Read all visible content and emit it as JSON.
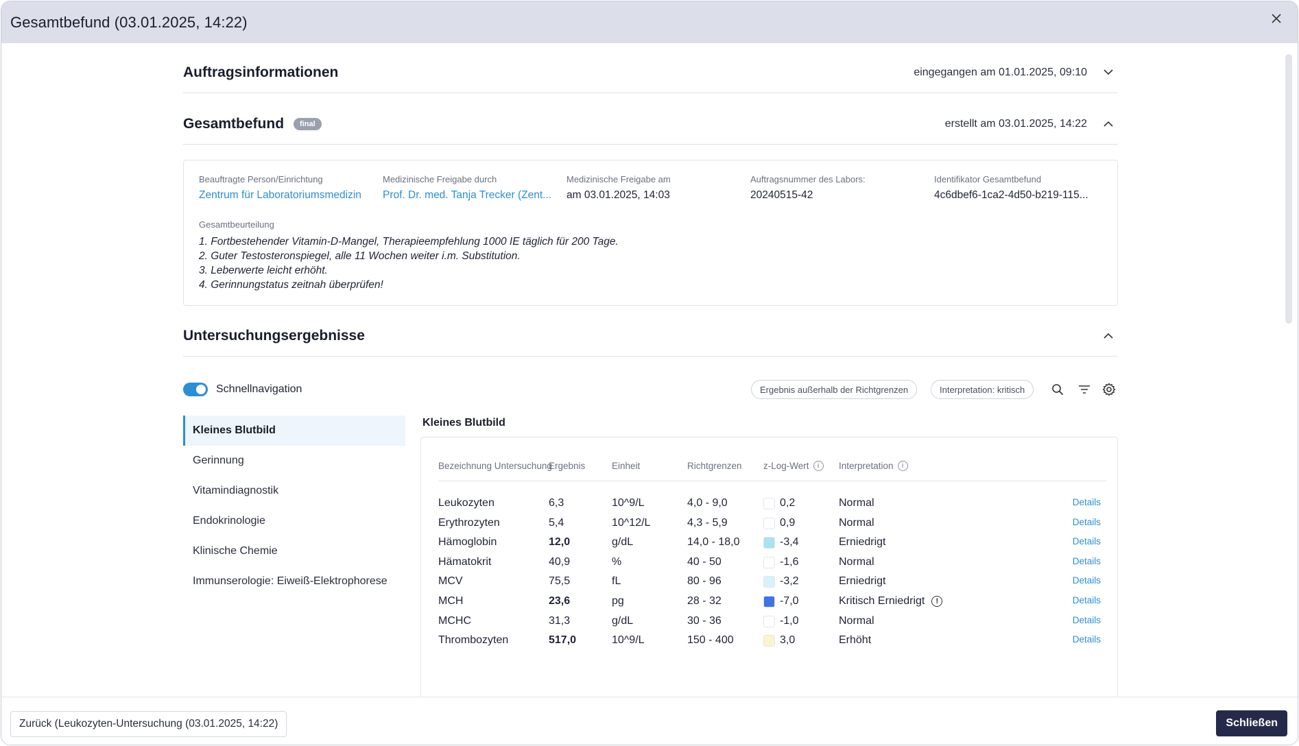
{
  "window": {
    "title": "Gesamtbefund (03.01.2025, 14:22)"
  },
  "order_section": {
    "title": "Auftragsinformationen",
    "meta": "eingegangen am 01.01.2025, 09:10"
  },
  "report_section": {
    "title": "Gesamtbefund",
    "badge": "final",
    "meta": "erstellt am 03.01.2025, 14:22",
    "fields": [
      {
        "label": "Beauftragte Person/Einrichtung",
        "value": "Zentrum für Laboratoriumsmedizin",
        "link": true
      },
      {
        "label": "Medizinische Freigabe durch",
        "value": "Prof. Dr. med. Tanja Trecker (Zent...",
        "link": true
      },
      {
        "label": "Medizinische Freigabe am",
        "value": "am 03.01.2025, 14:03",
        "link": false
      },
      {
        "label": "Auftragsnummer des Labors:",
        "value": "20240515-42",
        "link": false
      },
      {
        "label": "Identifikator Gesamtbefund",
        "value": "4c6dbef6-1ca2-4d50-b219-115...",
        "link": false
      }
    ],
    "assessment_label": "Gesamtbeurteilung",
    "assessment_lines": [
      "1. Fortbestehender Vitamin-D-Mangel, Therapieempfehlung 1000 IE täglich für 200 Tage.",
      "2. Guter Testosteronspiegel, alle 11 Wochen weiter i.m. Substitution.",
      "3. Leberwerte leicht erhöht.",
      "4. Gerinnungstatus zeitnah überprüfen!"
    ]
  },
  "results_section": {
    "title": "Untersuchungsergebnisse",
    "quicknav_label": "Schnellnavigation",
    "quicknav_on": true,
    "filters": [
      "Ergebnis außerhalb der Richtgrenzen",
      "Interpretation: kritisch"
    ],
    "nav_items": [
      "Kleines Blutbild",
      "Gerinnung",
      "Vitamindiagnostik",
      "Endokrinologie",
      "Klinische Chemie",
      "Immunserologie: Eiweiß-Elektrophorese"
    ],
    "active_nav": 0,
    "group_title": "Kleines Blutbild",
    "columns": [
      "Bezeichnung Untersuchung",
      "Ergebnis",
      "Einheit",
      "Richtgrenzen",
      "z-Log-Wert",
      "Interpretation"
    ],
    "details_label": "Details",
    "rows": [
      {
        "name": "Leukozyten",
        "result": "6,3",
        "bold": false,
        "unit": "10^9/L",
        "range": "4,0 - 9,0",
        "zcolor": "#ffffff",
        "zlog": "0,2",
        "interp": "Normal",
        "warn": false
      },
      {
        "name": "Erythrozyten",
        "result": "5,4",
        "bold": false,
        "unit": "10^12/L",
        "range": "4,3 - 5,9",
        "zcolor": "#ffffff",
        "zlog": "0,9",
        "interp": "Normal",
        "warn": false
      },
      {
        "name": "Hämoglobin",
        "result": "12,0",
        "bold": true,
        "unit": "g/dL",
        "range": "14,0 - 18,0",
        "zcolor": "#a8e2f3",
        "zlog": "-3,4",
        "interp": "Erniedrigt",
        "warn": false
      },
      {
        "name": "Hämatokrit",
        "result": "40,9",
        "bold": false,
        "unit": "%",
        "range": "40 - 50",
        "zcolor": "#ffffff",
        "zlog": "-1,6",
        "interp": "Normal",
        "warn": false
      },
      {
        "name": "MCV",
        "result": "75,5",
        "bold": false,
        "unit": "fL",
        "range": "80 - 96",
        "zcolor": "#d8f2fa",
        "zlog": "-3,2",
        "interp": "Erniedrigt",
        "warn": false
      },
      {
        "name": "MCH",
        "result": "23,6",
        "bold": true,
        "unit": "pg",
        "range": "28 - 32",
        "zcolor": "#3f73e8",
        "zlog": "-7,0",
        "interp": "Kritisch Erniedrigt",
        "warn": true
      },
      {
        "name": "MCHC",
        "result": "31,3",
        "bold": false,
        "unit": "g/dL",
        "range": "30 - 36",
        "zcolor": "#ffffff",
        "zlog": "-1,0",
        "interp": "Normal",
        "warn": false
      },
      {
        "name": "Thrombozyten",
        "result": "517,0",
        "bold": true,
        "unit": "10^9/L",
        "range": "150 - 400",
        "zcolor": "#fcf3cf",
        "zlog": "3,0",
        "interp": "Erhöht",
        "warn": false
      }
    ]
  },
  "footer": {
    "back_label": "Zurück (Leukozyten-Untersuchung (03.01.2025, 14:22)",
    "close_label": "Schließen"
  }
}
